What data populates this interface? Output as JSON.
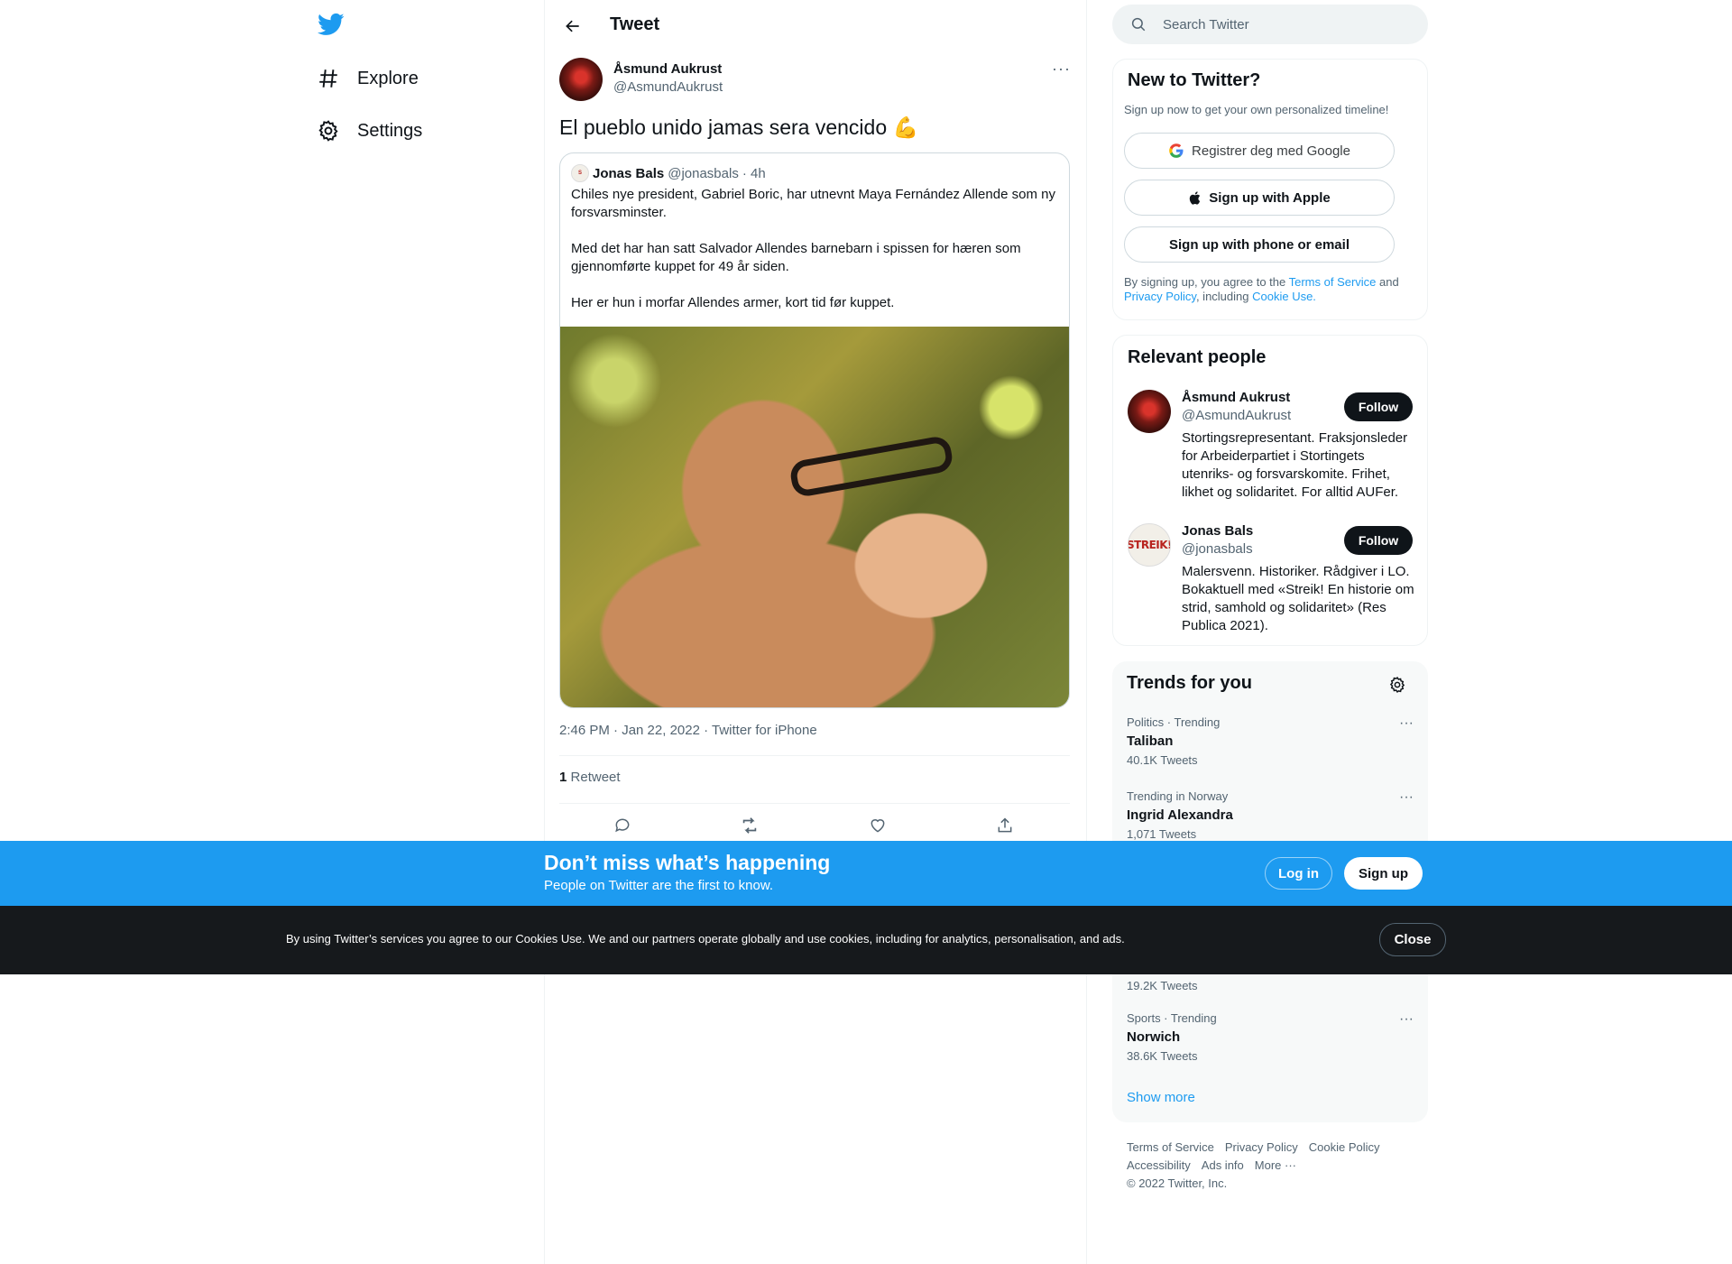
{
  "nav": {
    "items": [
      {
        "label": "Explore",
        "icon": "hashtag-icon"
      },
      {
        "label": "Settings",
        "icon": "gear-icon"
      }
    ]
  },
  "header": {
    "title": "Tweet"
  },
  "tweet": {
    "author_name": "Åsmund Aukrust",
    "author_handle": "@AsmundAukrust",
    "text": "El pueblo unido jamas sera vencido 💪",
    "meta": "2:46 PM · Jan 22, 2022 · Twitter for iPhone",
    "retweet_count": "1",
    "retweet_label": "Retweet",
    "quote": {
      "author_name": "Jonas Bals",
      "author_handle": "@jonasbals",
      "time": "· 4h",
      "paragraphs": [
        "Chiles nye president, Gabriel Boric, har utnevnt Maya Fernández Allende som ny forsvarsminster.",
        "Med det har han satt Salvador Allendes barnebarn i spissen for hæren som gjennomførte kuppet for 49 år siden.",
        "Her er hun i morfar Allendes armer, kort tid før kuppet."
      ]
    }
  },
  "search": {
    "placeholder": "Search Twitter"
  },
  "new_to_twitter": {
    "title": "New to Twitter?",
    "subtitle": "Sign up now to get your own personalized timeline!",
    "google_label": "Registrer deg med Google",
    "apple_label": "Sign up with Apple",
    "phone_label": "Sign up with phone or email",
    "legal_1": "By signing up, you agree to the ",
    "terms": "Terms of Service",
    "legal_2": " and",
    "privacy": "Privacy Policy",
    "legal_3": ", including ",
    "cookie": "Cookie Use."
  },
  "relevant_people": {
    "title": "Relevant people",
    "people": [
      {
        "name": "Åsmund Aukrust",
        "handle": "@AsmundAukrust",
        "bio": "Stortingsrepresentant. Fraksjonsleder for Arbeiderpartiet i Stortingets utenriks- og forsvarskomite. Frihet, likhet og solidaritet. For alltid AUFer.",
        "follow": "Follow"
      },
      {
        "name": "Jonas Bals",
        "handle": "@jonasbals",
        "bio": "Malersvenn. Historiker. Rådgiver i LO. Bokaktuell med «Streik! En historie om strid, samhold og solidaritet» (Res Publica 2021).",
        "follow": "Follow",
        "avatar_text": "STREIK!"
      }
    ]
  },
  "trends": {
    "title": "Trends for you",
    "items": [
      {
        "context": "Politics · Trending",
        "name": "Taliban",
        "count": "40.1K Tweets"
      },
      {
        "context": "Trending in Norway",
        "name": "Ingrid Alexandra",
        "count": "1,071 Tweets"
      },
      {
        "count": "19.2K Tweets"
      },
      {
        "context": "Sports · Trending",
        "name": "Norwich",
        "count": "38.6K Tweets"
      }
    ],
    "show_more": "Show more"
  },
  "footer": {
    "links": [
      "Terms of Service",
      "Privacy Policy",
      "Cookie Policy",
      "Accessibility",
      "Ads info",
      "More ···"
    ],
    "copyright": "© 2022 Twitter, Inc."
  },
  "banner": {
    "title": "Don’t miss what’s happening",
    "subtitle": "People on Twitter are the first to know.",
    "login": "Log in",
    "signup": "Sign up"
  },
  "cookie_bar": {
    "text": "By using Twitter’s services you agree to our Cookies Use. We and our partners operate globally and use cookies, including for analytics, personalisation, and ads.",
    "close": "Close"
  },
  "colors": {
    "accent": "#1d9bf0",
    "text": "#0f1419",
    "muted": "#536471",
    "cookie_bg": "#16191c"
  }
}
